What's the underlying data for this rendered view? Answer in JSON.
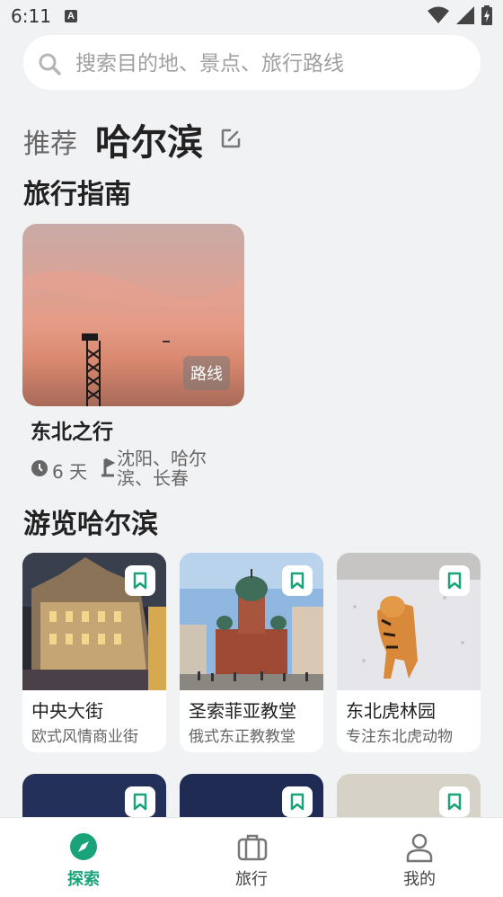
{
  "status_bar": {
    "time": "6:11",
    "badge": "A"
  },
  "search": {
    "placeholder": "搜索目的地、景点、旅行路线"
  },
  "recommend": {
    "label": "推荐",
    "city": "哈尔滨"
  },
  "guide_section": {
    "title": "旅行指南",
    "card": {
      "tag": "路线",
      "title": "东北之行",
      "days": "6 天",
      "cities": "沈阳、哈尔滨、长春"
    }
  },
  "tour_section": {
    "title": "游览哈尔滨",
    "places": [
      {
        "name": "中央大街",
        "desc": "欧式风情商业街"
      },
      {
        "name": "圣索菲亚教堂",
        "desc": "俄式东正教教堂"
      },
      {
        "name": "东北虎林园",
        "desc": "专注东北虎动物"
      }
    ]
  },
  "bottom_nav": {
    "items": [
      {
        "label": "探索",
        "icon": "compass-icon",
        "active": true
      },
      {
        "label": "旅行",
        "icon": "suitcase-icon",
        "active": false
      },
      {
        "label": "我的",
        "icon": "person-icon",
        "active": false
      }
    ]
  },
  "colors": {
    "accent": "#1aa37a",
    "background": "#f1f2f4"
  }
}
